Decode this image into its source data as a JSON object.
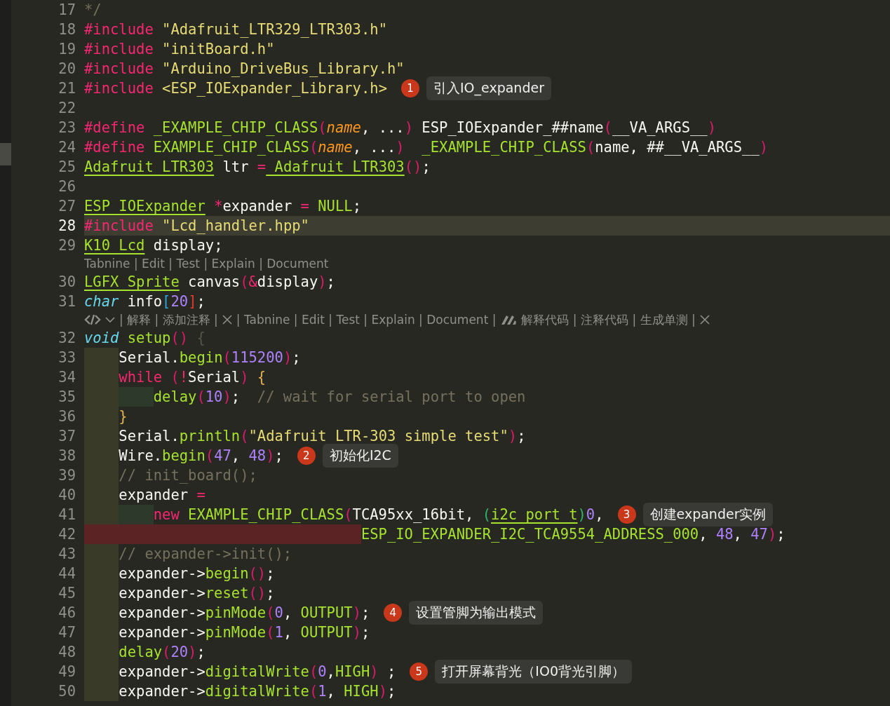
{
  "lines": [
    {
      "kind": "code",
      "number": "17",
      "current": false,
      "tokens": [
        {
          "text": "*/",
          "kind": "comment"
        }
      ]
    },
    {
      "kind": "code",
      "number": "18",
      "current": false,
      "tokens": [
        {
          "text": "#include",
          "kind": "kw"
        },
        {
          "text": " \"Adafruit_LTR329_LTR303.h\"",
          "kind": "str"
        }
      ]
    },
    {
      "kind": "code",
      "number": "19",
      "current": false,
      "tokens": [
        {
          "text": "#include",
          "kind": "kw"
        },
        {
          "text": " \"initBoard.h\"",
          "kind": "str"
        }
      ]
    },
    {
      "kind": "code",
      "number": "20",
      "current": false,
      "tokens": [
        {
          "text": "#include",
          "kind": "kw"
        },
        {
          "text": " \"Arduino_DriveBus_Library.h\"",
          "kind": "str"
        }
      ]
    },
    {
      "kind": "code",
      "number": "21",
      "current": false,
      "tokens": [
        {
          "text": "#include",
          "kind": "kw"
        },
        {
          "text": " <ESP_IOExpander_Library.h>",
          "kind": "str"
        }
      ],
      "note": {
        "badge": "1",
        "text": "引入IO_expander"
      }
    },
    {
      "kind": "code",
      "number": "22",
      "current": false
    },
    {
      "kind": "code",
      "number": "23",
      "current": false,
      "tokens": [
        {
          "text": "#define",
          "kind": "kw"
        },
        {
          "text": " _EXAMPLE_CHIP_CLASS",
          "kind": "fn"
        },
        {
          "text": "(",
          "kind": "paren"
        },
        {
          "text": "name",
          "kind": "param"
        },
        {
          "text": ", ...",
          "kind": "plain"
        },
        {
          "text": ")",
          "kind": "paren"
        },
        {
          "text": " ESP_IOExpander_##name",
          "kind": "plain"
        },
        {
          "text": "(",
          "kind": "paren"
        },
        {
          "text": "__VA_ARGS__",
          "kind": "plain"
        },
        {
          "text": ")",
          "kind": "paren"
        }
      ]
    },
    {
      "kind": "code",
      "number": "24",
      "current": false,
      "tokens": [
        {
          "text": "#define",
          "kind": "kw"
        },
        {
          "text": " EXAMPLE_CHIP_CLASS",
          "kind": "fn"
        },
        {
          "text": "(",
          "kind": "paren"
        },
        {
          "text": "name",
          "kind": "param"
        },
        {
          "text": ", ...",
          "kind": "plain"
        },
        {
          "text": ")",
          "kind": "paren"
        },
        {
          "text": "  _EXAMPLE_CHIP_CLASS",
          "kind": "fn"
        },
        {
          "text": "(",
          "kind": "paren"
        },
        {
          "text": "name, ##__VA_ARGS__",
          "kind": "plain"
        },
        {
          "text": ")",
          "kind": "paren"
        }
      ]
    },
    {
      "kind": "code",
      "number": "25",
      "current": false,
      "tokens": [
        {
          "text": "Adafruit_LTR303",
          "kind": "type"
        },
        {
          "text": " ltr ",
          "kind": "plain"
        },
        {
          "text": "=",
          "kind": "kw"
        },
        {
          "text": " Adafruit_LTR303",
          "kind": "type"
        },
        {
          "text": "()",
          "kind": "paren"
        },
        {
          "text": ";",
          "kind": "plain"
        }
      ]
    },
    {
      "kind": "code",
      "number": "26",
      "current": false
    },
    {
      "kind": "code",
      "number": "27",
      "current": false,
      "tokens": [
        {
          "text": "ESP_IOExpander",
          "kind": "type"
        },
        {
          "text": " *",
          "kind": "kw"
        },
        {
          "text": "expander ",
          "kind": "plain"
        },
        {
          "text": "=",
          "kind": "kw"
        },
        {
          "text": " NULL",
          "kind": "fn"
        },
        {
          "text": ";",
          "kind": "plain"
        }
      ]
    },
    {
      "kind": "code",
      "number": "28",
      "current": true,
      "tokens": [
        {
          "text": "#include",
          "kind": "kw"
        },
        {
          "text": " \"Lcd_handler.hpp\"",
          "kind": "str"
        }
      ]
    },
    {
      "kind": "code",
      "number": "29",
      "current": false,
      "tokens": [
        {
          "text": "K10_Lcd",
          "kind": "type"
        },
        {
          "text": " display;",
          "kind": "plain"
        }
      ]
    },
    {
      "kind": "lens",
      "items": [
        {
          "kind": "text",
          "text": "Tabnine | Edit | Test | Explain | Document"
        }
      ]
    },
    {
      "kind": "code",
      "number": "30",
      "current": false,
      "tokens": [
        {
          "text": "LGFX_Sprite",
          "kind": "type"
        },
        {
          "text": " canvas",
          "kind": "plain"
        },
        {
          "text": "(",
          "kind": "paren"
        },
        {
          "text": "&",
          "kind": "kw"
        },
        {
          "text": "display",
          "kind": "plain"
        },
        {
          "text": ")",
          "kind": "paren"
        },
        {
          "text": ";",
          "kind": "plain"
        }
      ]
    },
    {
      "kind": "code",
      "number": "31",
      "current": false,
      "tokens": [
        {
          "text": "char",
          "kind": "storage"
        },
        {
          "text": " info",
          "kind": "plain"
        },
        {
          "text": "[",
          "kind": "bracket"
        },
        {
          "text": "20",
          "kind": "num"
        },
        {
          "text": "]",
          "kind": "bracket2"
        },
        {
          "text": ";",
          "kind": "plain"
        }
      ]
    },
    {
      "kind": "lens",
      "items": [
        {
          "kind": "code"
        },
        {
          "kind": "chevron"
        },
        {
          "kind": "text",
          "text": "| 解释 | 添加注释 |"
        },
        {
          "kind": "close"
        },
        {
          "kind": "text",
          "text": "| Tabnine | Edit | Test | Explain | Document |"
        },
        {
          "kind": "logo"
        },
        {
          "kind": "text",
          "text": "解释代码 | 注释代码 | 生成单测 |"
        },
        {
          "kind": "close"
        }
      ]
    },
    {
      "kind": "code",
      "number": "32",
      "current": false,
      "tokens": [
        {
          "text": "void",
          "kind": "storage"
        },
        {
          "text": " setup",
          "kind": "fn"
        },
        {
          "text": "()",
          "kind": "paren"
        },
        {
          "text": " {",
          "kind": "dim"
        }
      ]
    },
    {
      "kind": "code",
      "number": "33",
      "current": false,
      "indent": [
        {
          "kind": "l1"
        }
      ],
      "tokens": [
        {
          "text": "Serial.",
          "kind": "plain"
        },
        {
          "text": "begin",
          "kind": "fn"
        },
        {
          "text": "(",
          "kind": "paren"
        },
        {
          "text": "115200",
          "kind": "num"
        },
        {
          "text": ")",
          "kind": "paren"
        },
        {
          "text": ";",
          "kind": "plain"
        }
      ]
    },
    {
      "kind": "code",
      "number": "34",
      "current": false,
      "indent": [
        {
          "kind": "l1"
        }
      ],
      "tokens": [
        {
          "text": "while",
          "kind": "kw"
        },
        {
          "text": " (",
          "kind": "paren"
        },
        {
          "text": "!",
          "kind": "kw"
        },
        {
          "text": "Serial",
          "kind": "plain"
        },
        {
          "text": ")",
          "kind": "paren"
        },
        {
          "text": " {",
          "kind": "brace"
        }
      ]
    },
    {
      "kind": "code",
      "number": "35",
      "current": false,
      "indent": [
        {
          "kind": "l1"
        },
        {
          "kind": "l2"
        }
      ],
      "tokens": [
        {
          "text": "delay",
          "kind": "fn"
        },
        {
          "text": "(",
          "kind": "paren"
        },
        {
          "text": "10",
          "kind": "num"
        },
        {
          "text": ")",
          "kind": "paren"
        },
        {
          "text": ";",
          "kind": "plain"
        },
        {
          "text": "  // wait for serial port to open",
          "kind": "comment"
        }
      ]
    },
    {
      "kind": "code",
      "number": "36",
      "current": false,
      "indent": [
        {
          "kind": "l1"
        }
      ],
      "tokens": [
        {
          "text": "}",
          "kind": "brace"
        }
      ]
    },
    {
      "kind": "code",
      "number": "37",
      "current": false,
      "indent": [
        {
          "kind": "l1"
        }
      ],
      "tokens": [
        {
          "text": "Serial.",
          "kind": "plain"
        },
        {
          "text": "println",
          "kind": "fn"
        },
        {
          "text": "(",
          "kind": "paren"
        },
        {
          "text": "\"Adafruit LTR-303 simple test\"",
          "kind": "str"
        },
        {
          "text": ")",
          "kind": "paren"
        },
        {
          "text": ";",
          "kind": "plain"
        }
      ]
    },
    {
      "kind": "code",
      "number": "38",
      "current": false,
      "indent": [
        {
          "kind": "l1"
        }
      ],
      "tokens": [
        {
          "text": "Wire.",
          "kind": "plain"
        },
        {
          "text": "begin",
          "kind": "fn"
        },
        {
          "text": "(",
          "kind": "paren"
        },
        {
          "text": "47",
          "kind": "num"
        },
        {
          "text": ", ",
          "kind": "plain"
        },
        {
          "text": "48",
          "kind": "num"
        },
        {
          "text": ")",
          "kind": "paren"
        },
        {
          "text": ";",
          "kind": "plain"
        }
      ],
      "note": {
        "badge": "2",
        "text": "初始化I2C"
      }
    },
    {
      "kind": "code",
      "number": "39",
      "current": false,
      "indent": [
        {
          "kind": "l1"
        }
      ],
      "tokens": [
        {
          "text": "// init_board();",
          "kind": "comment"
        }
      ]
    },
    {
      "kind": "code",
      "number": "40",
      "current": false,
      "indent": [
        {
          "kind": "l1"
        }
      ],
      "tokens": [
        {
          "text": "expander ",
          "kind": "plain"
        },
        {
          "text": "=",
          "kind": "kw"
        }
      ]
    },
    {
      "kind": "code",
      "number": "41",
      "current": false,
      "indent": [
        {
          "kind": "l1"
        },
        {
          "kind": "l2"
        }
      ],
      "tokens": [
        {
          "text": "new",
          "kind": "kw"
        },
        {
          "text": " EXAMPLE_CHIP_CLASS",
          "kind": "fn"
        },
        {
          "text": "(",
          "kind": "paren"
        },
        {
          "text": "TCA95xx_16bit, ",
          "kind": "plain"
        },
        {
          "text": "(",
          "kind": "paren2"
        },
        {
          "text": "i2c_port_t",
          "kind": "type"
        },
        {
          "text": ")",
          "kind": "paren2"
        },
        {
          "text": "0",
          "kind": "num"
        },
        {
          "text": ",",
          "kind": "plain"
        }
      ],
      "note": {
        "badge": "3",
        "text": "创建expander实例"
      }
    },
    {
      "kind": "code",
      "number": "42",
      "current": false,
      "indent": [
        {
          "kind": "err"
        },
        {
          "kind": "err"
        },
        {
          "kind": "err"
        },
        {
          "kind": "err"
        },
        {
          "kind": "err"
        },
        {
          "kind": "err"
        },
        {
          "kind": "err"
        },
        {
          "kind": "err"
        }
      ],
      "tokens": [
        {
          "text": "ESP_IO_EXPANDER_I2C_TCA9554_ADDRESS_000",
          "kind": "fn"
        },
        {
          "text": ", ",
          "kind": "plain"
        },
        {
          "text": "48",
          "kind": "num"
        },
        {
          "text": ", ",
          "kind": "plain"
        },
        {
          "text": "47",
          "kind": "num"
        },
        {
          "text": ")",
          "kind": "paren"
        },
        {
          "text": ";",
          "kind": "plain"
        }
      ]
    },
    {
      "kind": "code",
      "number": "43",
      "current": false,
      "indent": [
        {
          "kind": "l1"
        }
      ],
      "tokens": [
        {
          "text": "// expander->init();",
          "kind": "comment"
        }
      ]
    },
    {
      "kind": "code",
      "number": "44",
      "current": false,
      "indent": [
        {
          "kind": "l1"
        }
      ],
      "tokens": [
        {
          "text": "expander->",
          "kind": "plain"
        },
        {
          "text": "begin",
          "kind": "fn"
        },
        {
          "text": "()",
          "kind": "paren"
        },
        {
          "text": ";",
          "kind": "plain"
        }
      ]
    },
    {
      "kind": "code",
      "number": "45",
      "current": false,
      "indent": [
        {
          "kind": "l1"
        }
      ],
      "tokens": [
        {
          "text": "expander->",
          "kind": "plain"
        },
        {
          "text": "reset",
          "kind": "fn"
        },
        {
          "text": "()",
          "kind": "paren"
        },
        {
          "text": ";",
          "kind": "plain"
        }
      ]
    },
    {
      "kind": "code",
      "number": "46",
      "current": false,
      "indent": [
        {
          "kind": "l1"
        }
      ],
      "tokens": [
        {
          "text": "expander->",
          "kind": "plain"
        },
        {
          "text": "pinMode",
          "kind": "fn"
        },
        {
          "text": "(",
          "kind": "paren"
        },
        {
          "text": "0",
          "kind": "num"
        },
        {
          "text": ", ",
          "kind": "plain"
        },
        {
          "text": "OUTPUT",
          "kind": "fn"
        },
        {
          "text": ")",
          "kind": "paren"
        },
        {
          "text": ";",
          "kind": "plain"
        }
      ],
      "note": {
        "badge": "4",
        "text": "设置管脚为输出模式"
      }
    },
    {
      "kind": "code",
      "number": "47",
      "current": false,
      "indent": [
        {
          "kind": "l1"
        }
      ],
      "tokens": [
        {
          "text": "expander->",
          "kind": "plain"
        },
        {
          "text": "pinMode",
          "kind": "fn"
        },
        {
          "text": "(",
          "kind": "paren"
        },
        {
          "text": "1",
          "kind": "num"
        },
        {
          "text": ", ",
          "kind": "plain"
        },
        {
          "text": "OUTPUT",
          "kind": "fn"
        },
        {
          "text": ")",
          "kind": "paren"
        },
        {
          "text": ";",
          "kind": "plain"
        }
      ]
    },
    {
      "kind": "code",
      "number": "48",
      "current": false,
      "indent": [
        {
          "kind": "l1"
        }
      ],
      "tokens": [
        {
          "text": "delay",
          "kind": "fn"
        },
        {
          "text": "(",
          "kind": "paren"
        },
        {
          "text": "20",
          "kind": "num"
        },
        {
          "text": ")",
          "kind": "paren"
        },
        {
          "text": ";",
          "kind": "plain"
        }
      ]
    },
    {
      "kind": "code",
      "number": "49",
      "current": false,
      "indent": [
        {
          "kind": "l1"
        }
      ],
      "tokens": [
        {
          "text": "expander->",
          "kind": "plain"
        },
        {
          "text": "digitalWrite",
          "kind": "fn"
        },
        {
          "text": "(",
          "kind": "paren"
        },
        {
          "text": "0",
          "kind": "num"
        },
        {
          "text": ",",
          "kind": "plain"
        },
        {
          "text": "HIGH",
          "kind": "fn"
        },
        {
          "text": ")",
          "kind": "paren"
        },
        {
          "text": " ;",
          "kind": "plain"
        }
      ],
      "note": {
        "badge": "5",
        "text": "打开屏幕背光（IO0背光引脚）"
      }
    },
    {
      "kind": "code",
      "number": "50",
      "current": false,
      "indent": [
        {
          "kind": "l1"
        }
      ],
      "tokens": [
        {
          "text": "expander->",
          "kind": "plain"
        },
        {
          "text": "digitalWrite",
          "kind": "fn"
        },
        {
          "text": "(",
          "kind": "paren"
        },
        {
          "text": "1",
          "kind": "num"
        },
        {
          "text": ", ",
          "kind": "plain"
        },
        {
          "text": "HIGH",
          "kind": "fn"
        },
        {
          "text": ")",
          "kind": "paren"
        },
        {
          "text": ";",
          "kind": "plain"
        }
      ]
    }
  ]
}
